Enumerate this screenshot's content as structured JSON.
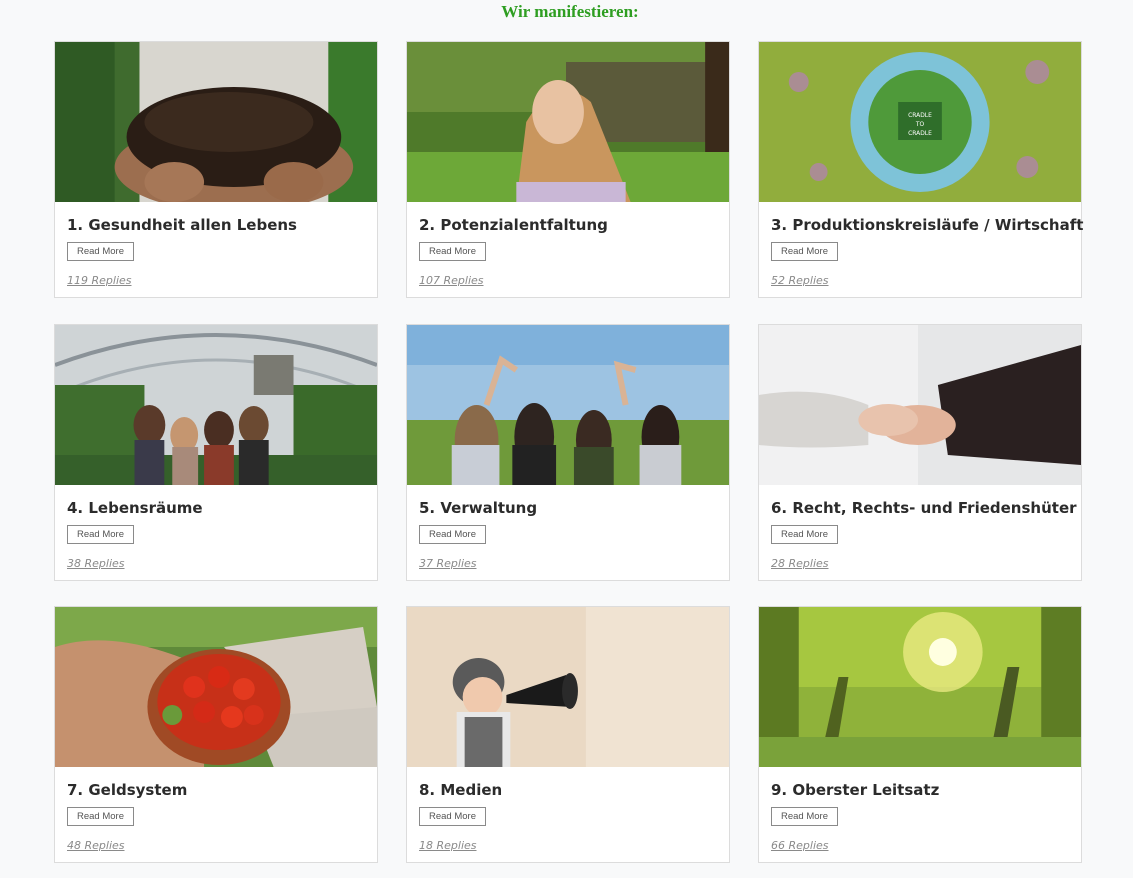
{
  "heading": "Wir manifestieren:",
  "read_more_label": "Read More",
  "cards": [
    {
      "title": "1. Gesundheit allen Lebens",
      "replies": "119 Replies",
      "image": "hands holding soil"
    },
    {
      "title": "2. Potenzialentfaltung",
      "replies": "107 Replies",
      "image": "girl looking up in forest"
    },
    {
      "title": "3. Produktionskreisläufe / Wirtschaft",
      "replies": "52 Replies",
      "image": "cradle to cradle globe"
    },
    {
      "title": "4. Lebensräume",
      "replies": "38 Replies",
      "image": "women in greenhouse"
    },
    {
      "title": "5. Verwaltung",
      "replies": "37 Replies",
      "image": "girls making heart hands in field"
    },
    {
      "title": "6. Recht, Rechts- und Friedenshüter",
      "replies": "28 Replies",
      "image": "handshake"
    },
    {
      "title": "7. Geldsystem",
      "replies": "48 Replies",
      "image": "bowl of tomatoes"
    },
    {
      "title": "8. Medien",
      "replies": "18 Replies",
      "image": "child with megaphone"
    },
    {
      "title": "9. Oberster Leitsatz",
      "replies": "66 Replies",
      "image": "sunlight through trees"
    }
  ],
  "image_text": {
    "cradle_line1": "CRADLE",
    "cradle_line2": "TO",
    "cradle_line3": "CRADLE"
  }
}
